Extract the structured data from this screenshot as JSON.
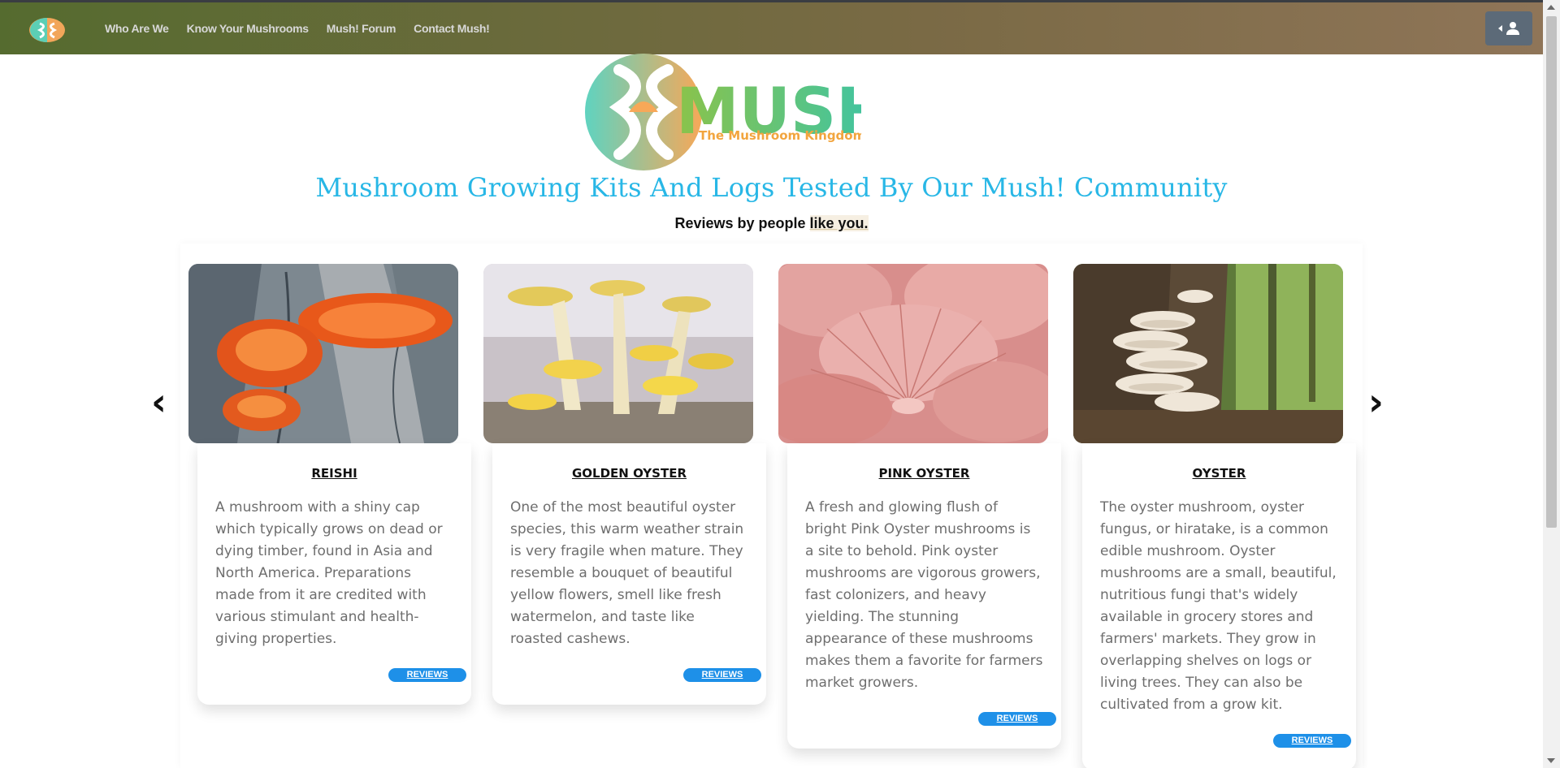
{
  "nav": {
    "items": [
      {
        "label": "Who Are We"
      },
      {
        "label": "Know Your Mushrooms"
      },
      {
        "label": "Mush! Forum"
      },
      {
        "label": "Contact Mush!"
      }
    ]
  },
  "hero": {
    "logo_text": "MUSH!",
    "logo_tagline": "The Mushroom Kingdom",
    "title": "Mushroom Growing Kits And Logs Tested By Our Mush! Community",
    "subtitle_pre": "Reviews by people ",
    "subtitle_hl": "like you."
  },
  "carousel": {
    "prev_label": "‹",
    "next_label": "›",
    "cards": [
      {
        "title": "REISHI",
        "description": "A mushroom with a shiny cap which typically grows on dead or dying timber, found in Asia and North America. Preparations made from it are credited with various stimulant and health-giving properties.",
        "button": "REVIEWS"
      },
      {
        "title": "GOLDEN OYSTER",
        "description": "One of the most beautiful oyster species, this warm weather strain is very fragile when mature. They resemble a bouquet of beautiful yellow flowers, smell like fresh watermelon, and taste like roasted cashews.",
        "button": "REVIEWS"
      },
      {
        "title": "PINK OYSTER",
        "description": "A fresh and glowing flush of bright Pink Oyster mushrooms is a site to behold. Pink oyster mushrooms are vigorous growers, fast colonizers, and heavy yielding. The stunning appearance of these mushrooms makes them a favorite for farmers market growers.",
        "button": "REVIEWS"
      },
      {
        "title": "OYSTER",
        "description": "The oyster mushroom, oyster fungus, or hiratake, is a common edible mushroom. Oyster mushrooms are a small, beautiful, nutritious fungi that's widely available in grocery stores and farmers' markets. They grow in overlapping shelves on logs or living trees. They can also be cultivated from a grow kit.",
        "button": "REVIEWS"
      }
    ]
  },
  "colors": {
    "title": "#28b7e6",
    "button": "#1e90e8",
    "nav_start": "#556b2f",
    "nav_end": "#8f7558"
  }
}
